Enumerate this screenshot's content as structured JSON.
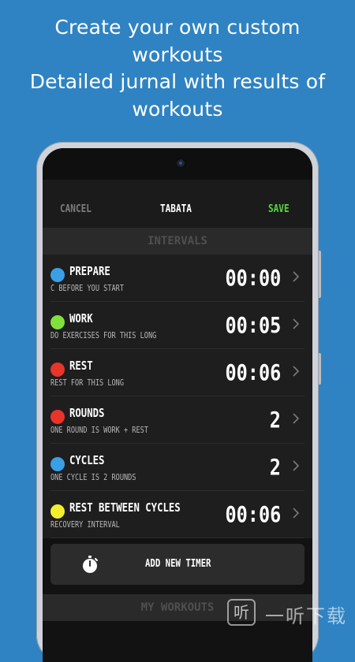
{
  "promo": {
    "lines": [
      "Create your own custom",
      "workouts",
      "Detailed jurnal with results of",
      "workouts"
    ]
  },
  "toolbar": {
    "cancel_label": "CANCEL",
    "title": "TABATA",
    "save_label": "SAVE"
  },
  "sections": {
    "intervals": "INTERVALS",
    "my_workouts": "MY WORKOUTS"
  },
  "intervals": [
    {
      "name": "PREPARE",
      "description": "C BEFORE YOU START",
      "value": "00:00",
      "color": "#3aa0e6"
    },
    {
      "name": "WORK",
      "description": "DO EXERCISES FOR THIS LONG",
      "value": "00:05",
      "color": "#82e03a"
    },
    {
      "name": "REST",
      "description": "REST FOR THIS LONG",
      "value": "00:06",
      "color": "#e8342a"
    },
    {
      "name": "ROUNDS",
      "description": "ONE ROUND IS WORK + REST",
      "value": "2",
      "color": "#e8342a"
    },
    {
      "name": "CYCLES",
      "description": "ONE CYCLE IS  2 ROUNDS",
      "value": "2",
      "color": "#3aa0e6"
    },
    {
      "name": "REST BETWEEN CYCLES",
      "description": "RECOVERY INTERVAL",
      "value": "00:06",
      "color": "#f2ee2e"
    }
  ],
  "add_timer": {
    "label": "ADD NEW TIMER",
    "icon": "stopwatch-icon"
  },
  "watermark": {
    "glyph": "听",
    "text": "一听下载"
  },
  "colors": {
    "background": "#2f83c2",
    "accent_save": "#59d63f"
  }
}
